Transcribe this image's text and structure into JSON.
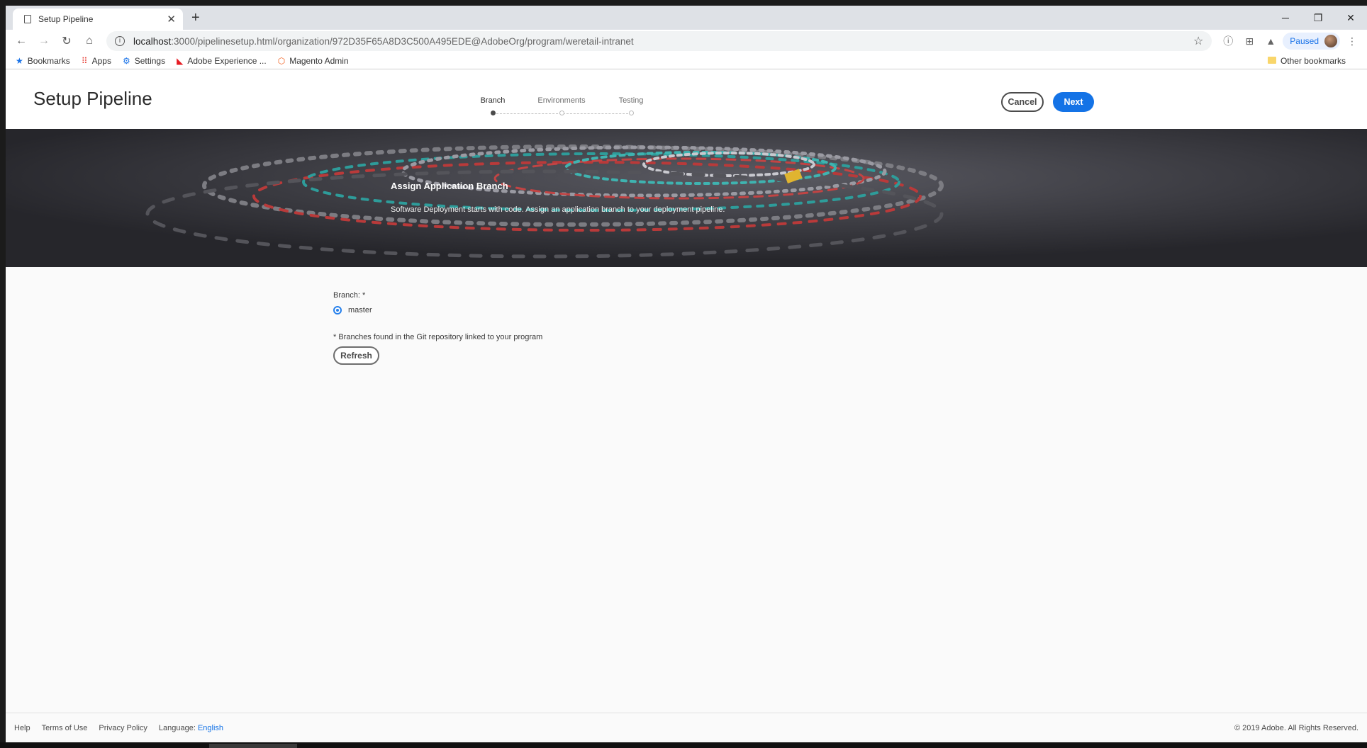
{
  "browser": {
    "tab_title": "Setup Pipeline",
    "tab_close": "✕",
    "new_tab": "+",
    "url_host": "localhost",
    "url_path": ":3000/pipelinesetup.html/organization/972D35F65A8D3C500A495EDE@AdobeOrg/program/weretail-intranet",
    "profile_status": "Paused",
    "bookmarks": [
      {
        "label": "Bookmarks",
        "icon": "star-icon",
        "glyph": "★",
        "color": "#1a73e8"
      },
      {
        "label": "Apps",
        "icon": "apps-grid-icon",
        "glyph": "⠿",
        "color": "#e8453c"
      },
      {
        "label": "Settings",
        "icon": "gear-icon",
        "glyph": "⚙",
        "color": "#1a73e8"
      },
      {
        "label": "Adobe Experience ...",
        "icon": "adobe-icon",
        "glyph": "◣",
        "color": "#e61c24"
      },
      {
        "label": "Magento Admin",
        "icon": "magento-icon",
        "glyph": "⬡",
        "color": "#f26322"
      }
    ],
    "other_bookmarks": "Other bookmarks"
  },
  "app": {
    "title": "Setup Pipeline",
    "steps": [
      {
        "label": "Branch",
        "active": true
      },
      {
        "label": "Environments",
        "active": false
      },
      {
        "label": "Testing",
        "active": false
      }
    ],
    "cancel_label": "Cancel",
    "next_label": "Next",
    "accent_color": "#1473e6"
  },
  "hero": {
    "title": "Assign Application Branch",
    "text": "Software Deployment starts with code. Assign an application branch to your deployment pipeline."
  },
  "form": {
    "branch_label": "Branch: *",
    "branch_option": "master",
    "branch_selected": true,
    "note": "* Branches found in the Git repository linked to your program",
    "refresh_label": "Refresh"
  },
  "footer": {
    "help": "Help",
    "terms": "Terms of Use",
    "privacy": "Privacy Policy",
    "language_label": "Language:",
    "language_value": "English",
    "copyright": "© 2019 Adobe. All Rights Reserved."
  }
}
